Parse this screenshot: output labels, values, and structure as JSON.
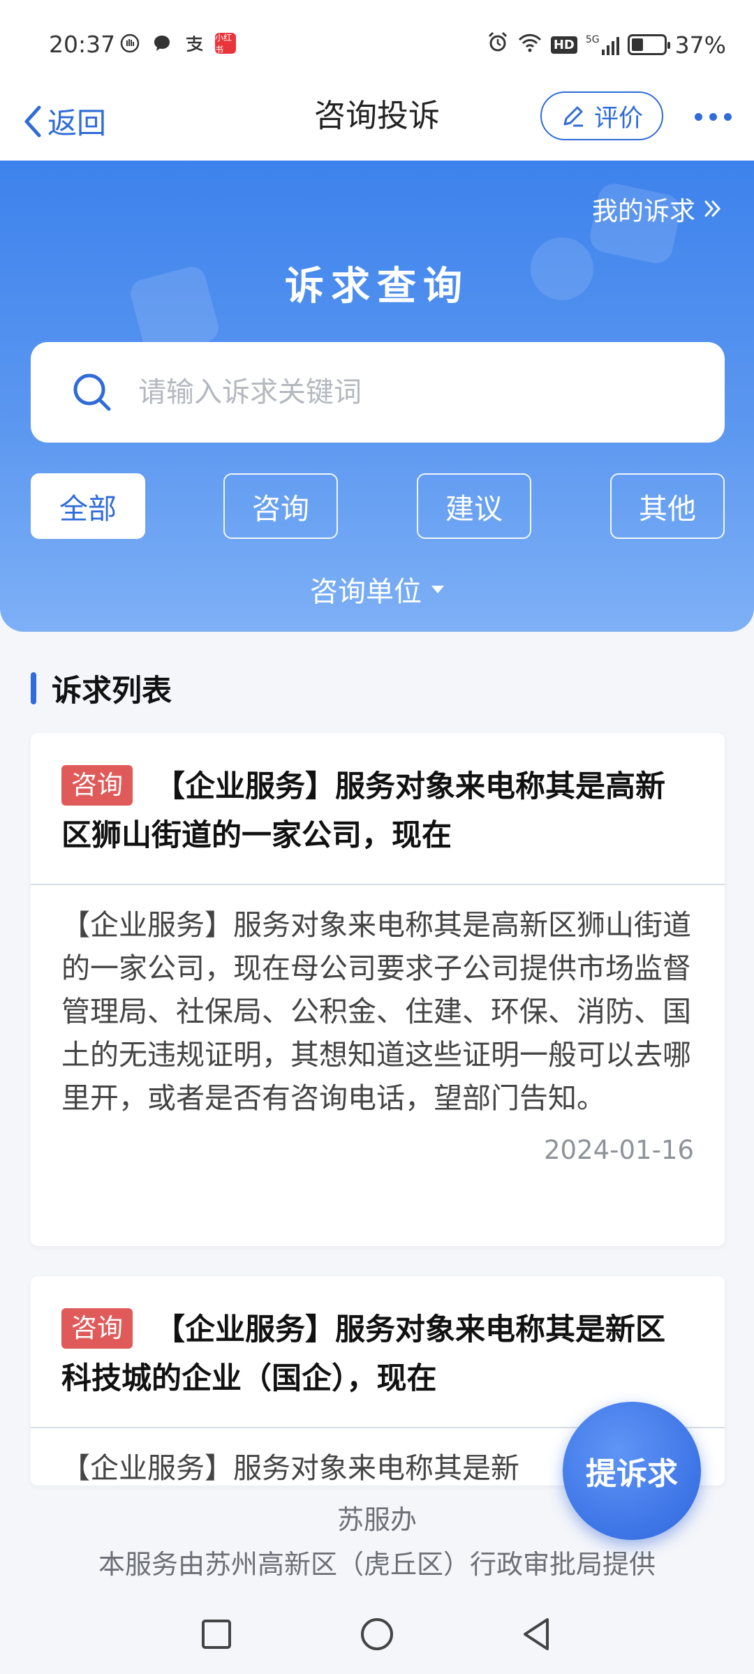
{
  "status_bar": {
    "time": "20:37",
    "left_icons": [
      "hand-icon",
      "message-icon",
      "alipay-icon",
      "app-icon"
    ],
    "app_icon_text": "小红书",
    "network": "HD",
    "signal": "5G",
    "battery_percent": "37%",
    "battery_level": 0.37
  },
  "nav": {
    "back_label": "返回",
    "title": "咨询投诉",
    "rate_label": "评价"
  },
  "hero": {
    "my_requests_label": "我的诉求",
    "title": "诉求查询",
    "search_placeholder": "请输入诉求关键词",
    "filters": [
      {
        "label": "全部",
        "active": true
      },
      {
        "label": "咨询",
        "active": false
      },
      {
        "label": "建议",
        "active": false
      },
      {
        "label": "其他",
        "active": false
      }
    ],
    "unit_select_label": "咨询单位"
  },
  "list": {
    "section_title": "诉求列表",
    "items": [
      {
        "tag": "咨询",
        "title": "【企业服务】服务对象来电称其是高新区狮山街道的一家公司，现在",
        "body": "【企业服务】服务对象来电称其是高新区狮山街道的一家公司，现在母公司要求子公司提供市场监督管理局、社保局、公积金、住建、环保、消防、国土的无违规证明，其想知道这些证明一般可以去哪里开，或者是否有咨询电话，望部门告知。",
        "date": "2024-01-16"
      },
      {
        "tag": "咨询",
        "title": "【企业服务】服务对象来电称其是新区科技城的企业（国企），现在",
        "body": "【企业服务】服务对象来电称其是新"
      }
    ]
  },
  "fab_label": "提诉求",
  "footer": {
    "line1": "苏服办",
    "line2": "本服务由苏州高新区（虎丘区）行政审批局提供"
  },
  "colors": {
    "accent": "#2f6bd9",
    "tag": "#e05a5a"
  }
}
